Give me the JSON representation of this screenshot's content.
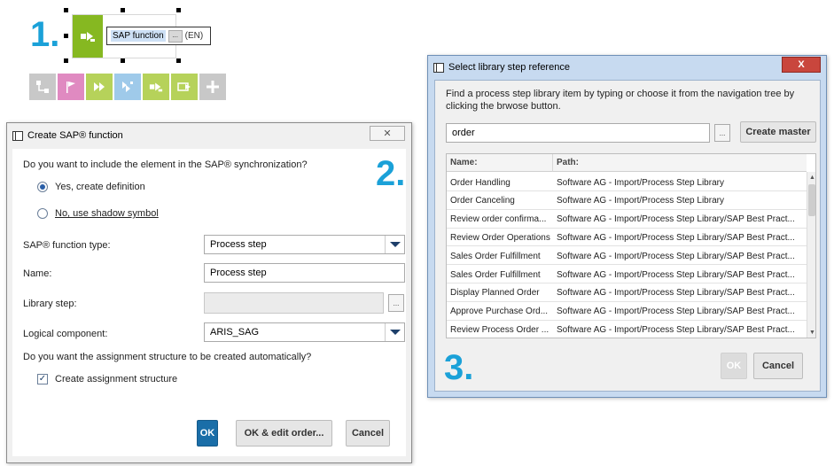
{
  "step_numbers": [
    "1.",
    "2.",
    "3."
  ],
  "diagram": {
    "inline_edit_text": "SAP function",
    "inline_edit_button": "...",
    "inline_edit_lang": "(EN)",
    "palette_colors": [
      "#c8c8c8",
      "#e08ac1",
      "#b6d25a",
      "#9fcaea",
      "#b6d25a",
      "#b6d25a",
      "#c8c8c8"
    ],
    "palette_icons": [
      "connector-icon",
      "flag-icon",
      "fast-forward-icon",
      "multi-step-icon",
      "sap-function-icon",
      "transaction-icon",
      "plus-icon"
    ]
  },
  "create_dialog": {
    "title": "Create SAP® function",
    "close_label": "✕",
    "question1": "Do you want to include the element in the SAP® synchronization?",
    "radio_yes": "Yes, create definition",
    "radio_no": "No, use shadow symbol",
    "function_type_label": "SAP® function type:",
    "function_type_value": "Process step",
    "name_label": "Name:",
    "name_value": "Process step",
    "library_label": "Library step:",
    "library_value": "",
    "library_browse": "...",
    "logical_label": "Logical component:",
    "logical_value": "ARIS_SAG",
    "question2": "Do you want the assignment structure to be created automatically?",
    "checkbox_label": "Create assignment structure",
    "checkbox_checked": true,
    "ok_label": "OK",
    "ok_edit_label": "OK & edit order...",
    "cancel_label": "Cancel"
  },
  "library_dialog": {
    "title": "Select library step reference",
    "close_label": "X",
    "instruction": "Find a process step library item by typing or choose it from the navigation tree by clicking the brwose button.",
    "search_value": "order",
    "browse_label": "...",
    "create_master_label": "Create master",
    "columns": [
      "Name:",
      "Path:"
    ],
    "rows": [
      [
        "Order Handling",
        "Software AG - Import/Process Step Library"
      ],
      [
        "Order Canceling",
        "Software AG - Import/Process Step Library"
      ],
      [
        "Review order confirma...",
        "Software AG - Import/Process Step Library/SAP Best Pract..."
      ],
      [
        "Review Order Operations",
        "Software AG - Import/Process Step Library/SAP Best Pract..."
      ],
      [
        "Sales Order Fulfillment",
        "Software AG - Import/Process Step Library/SAP Best Pract..."
      ],
      [
        "Sales Order Fulfillment",
        "Software AG - Import/Process Step Library/SAP Best Pract..."
      ],
      [
        "Display Planned Order",
        "Software AG - Import/Process Step Library/SAP Best Pract..."
      ],
      [
        "Approve Purchase Ord...",
        "Software AG - Import/Process Step Library/SAP Best Pract..."
      ],
      [
        "Review Process Order ...",
        "Software AG - Import/Process Step Library/SAP Best Pract..."
      ]
    ],
    "ok_label": "OK",
    "cancel_label": "Cancel"
  },
  "colors": {
    "accent_number": "#1ba1d8",
    "sap_green": "#86b821",
    "primary_button": "#1a6ea8",
    "close_red": "#c9463d"
  }
}
